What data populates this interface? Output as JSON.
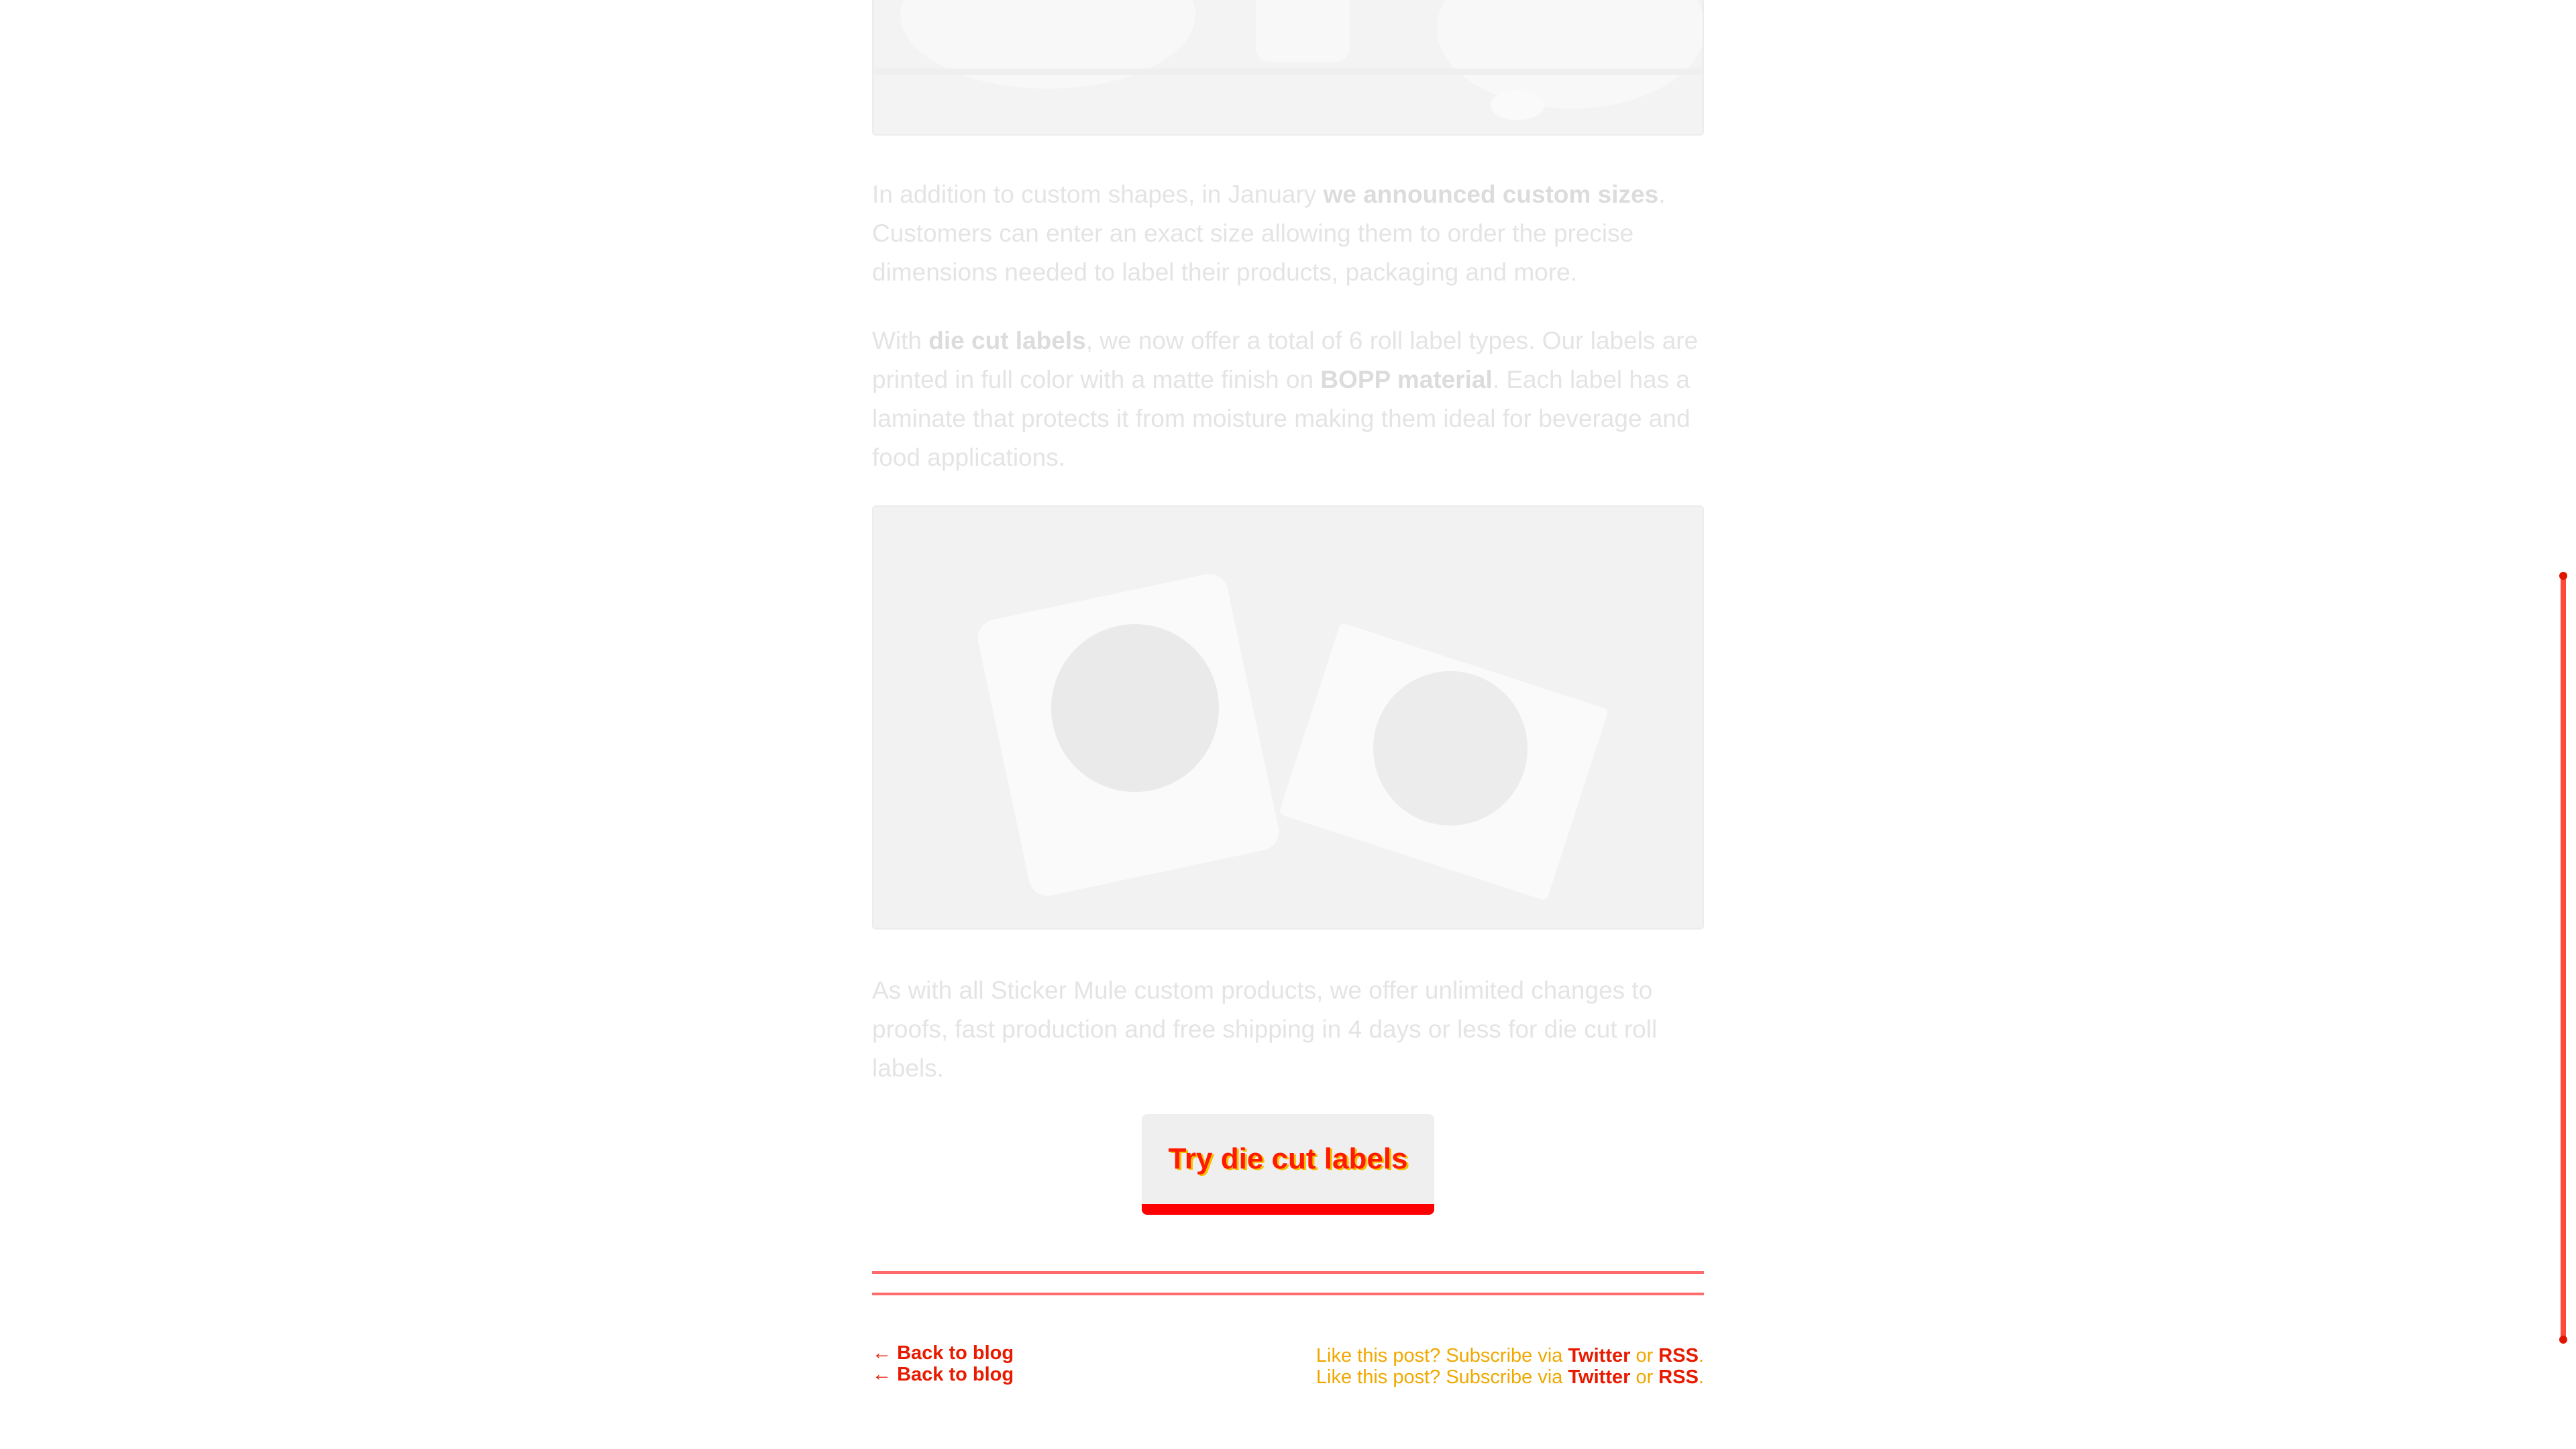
{
  "article": {
    "p1": {
      "t1": "In addition to custom shapes, in January ",
      "b1": "we announced custom sizes",
      "t2": ". Customers can enter an exact size allowing them to order the precise dimensions needed to label their products, packaging and more."
    },
    "p2": {
      "t1": "With ",
      "b1": "die cut labels",
      "t2": ", we now offer a total of 6 roll label types. Our labels are printed in full color with a matte finish on ",
      "b2": "BOPP material",
      "t3": ". Each label has a laminate that protects it from moisture making them ideal for beverage and food applications."
    },
    "p3": "As with all Sticker Mule custom products, we offer unlimited changes to proofs, fast production and free shipping in 4 days or less for die cut roll labels.",
    "cta_label": "Try die cut labels"
  },
  "footer": {
    "back_arrow": "←",
    "back_label": "Back to blog",
    "subscribe_prefix": "Like this post? Subscribe via ",
    "twitter": "Twitter",
    "or": " or ",
    "rss": "RSS",
    "period": "."
  },
  "colors": {
    "accent": "#ff0000",
    "link": "#e81a00",
    "faded_text": "#e4e4e4"
  }
}
